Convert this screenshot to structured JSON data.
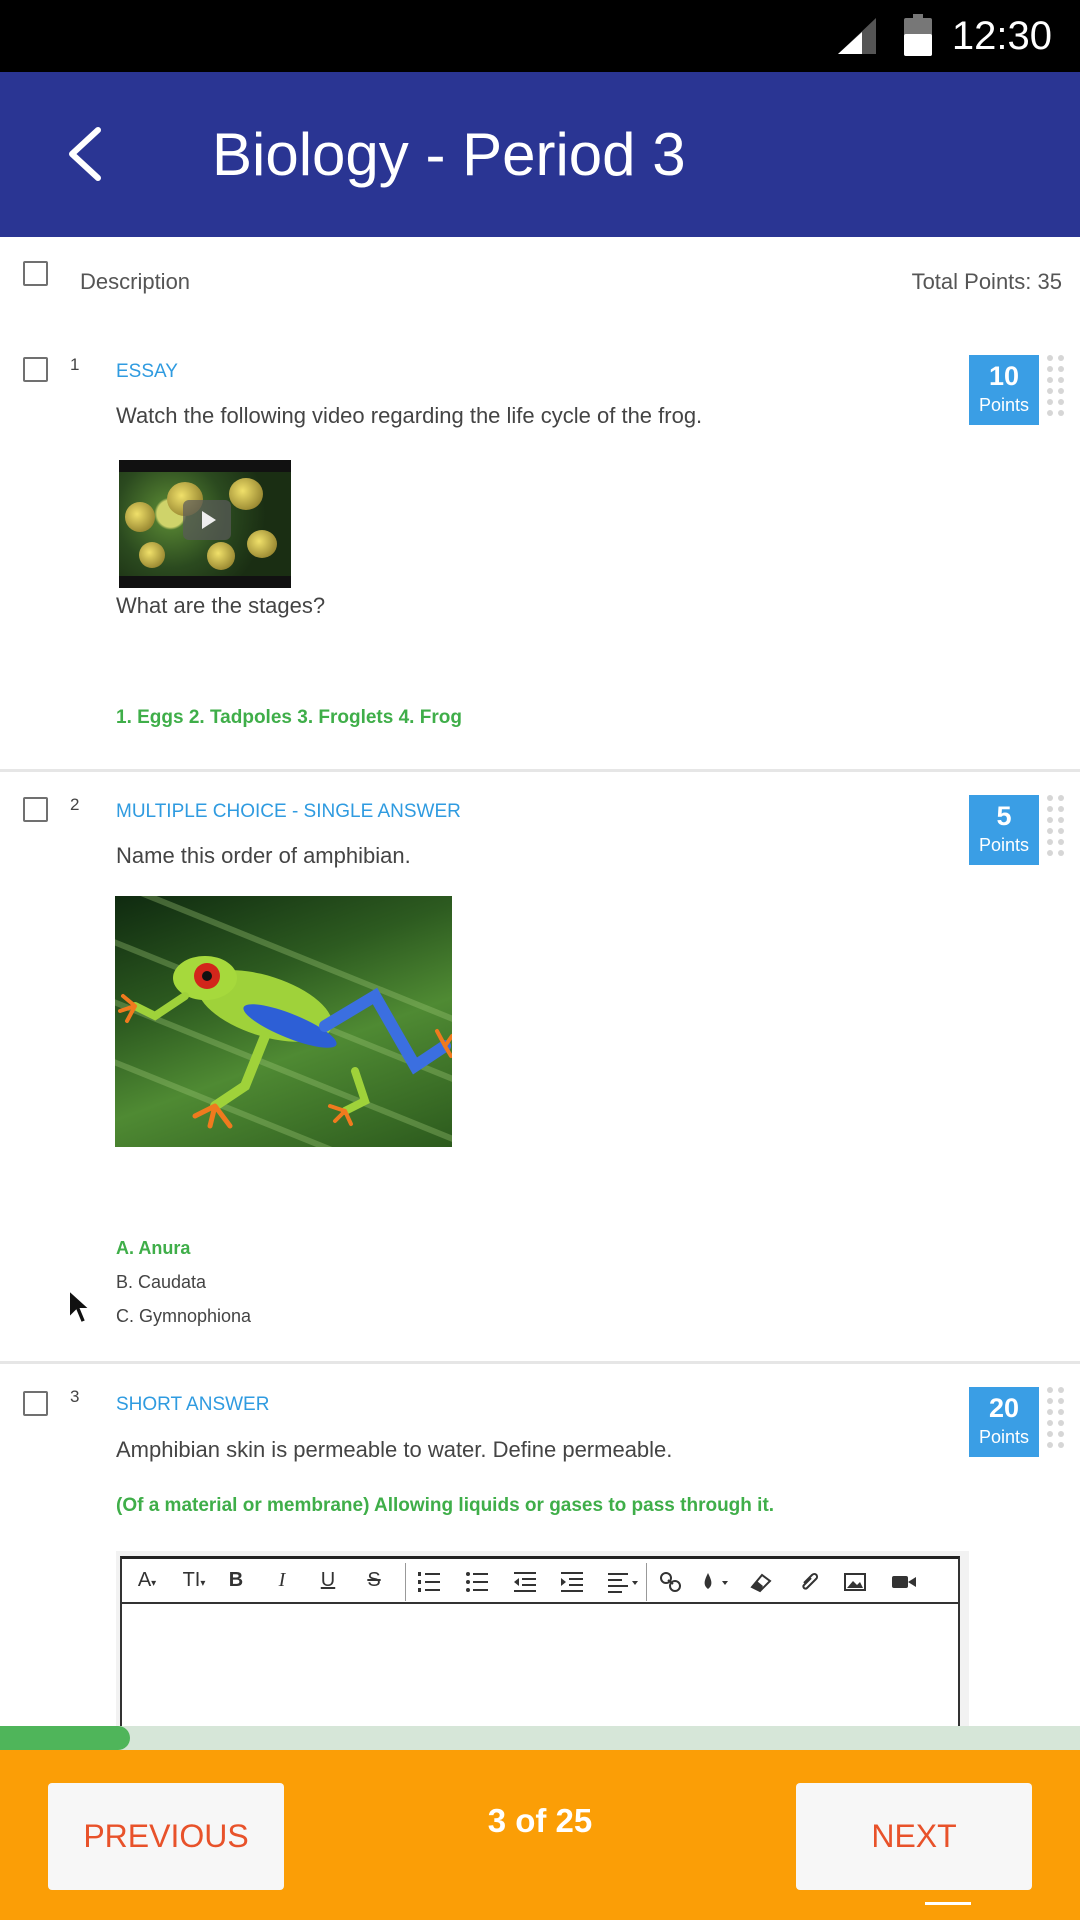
{
  "status_bar": {
    "time": "12:30"
  },
  "app_bar": {
    "title": "Biology - Period 3",
    "back_icon": "chevron-left-icon"
  },
  "description_row": {
    "label": "Description",
    "total_points": "Total Points: 35"
  },
  "questions": [
    {
      "number": "1",
      "type": "ESSAY",
      "text": "Watch the following video regarding the life cycle of the frog.",
      "subtext": "What are the stages?",
      "answer": "1. Eggs 2. Tadpoles 3. Froglets 4. Frog",
      "points": "10",
      "points_label": "Points"
    },
    {
      "number": "2",
      "type": "MULTIPLE CHOICE - SINGLE ANSWER",
      "text": "Name this order of amphibian.",
      "choices": [
        {
          "label": "A. Anura",
          "correct": true
        },
        {
          "label": "B. Caudata",
          "correct": false
        },
        {
          "label": "C. Gymnophiona",
          "correct": false
        }
      ],
      "points": "5",
      "points_label": "Points"
    },
    {
      "number": "3",
      "type": "SHORT ANSWER",
      "text": "Amphibian skin is permeable to water.  Define permeable.",
      "answer": "(Of a material or membrane) Allowing liquids or gases to pass through it.",
      "points": "20",
      "points_label": "Points"
    }
  ],
  "editor_toolbar": {
    "font": "A",
    "size": "TI",
    "bold": "B",
    "italic": "I",
    "underline": "U",
    "strike": "S"
  },
  "progress": {
    "fraction": 0.12
  },
  "bottom_bar": {
    "previous": "PREVIOUS",
    "pager": "3 of 25",
    "next": "NEXT"
  },
  "colors": {
    "app_bar": "#2a3593",
    "accent_blue": "#3a9ee5",
    "correct_green": "#3fae49",
    "bottom_bar": "#fb9e06",
    "nav_text": "#e8522a"
  }
}
